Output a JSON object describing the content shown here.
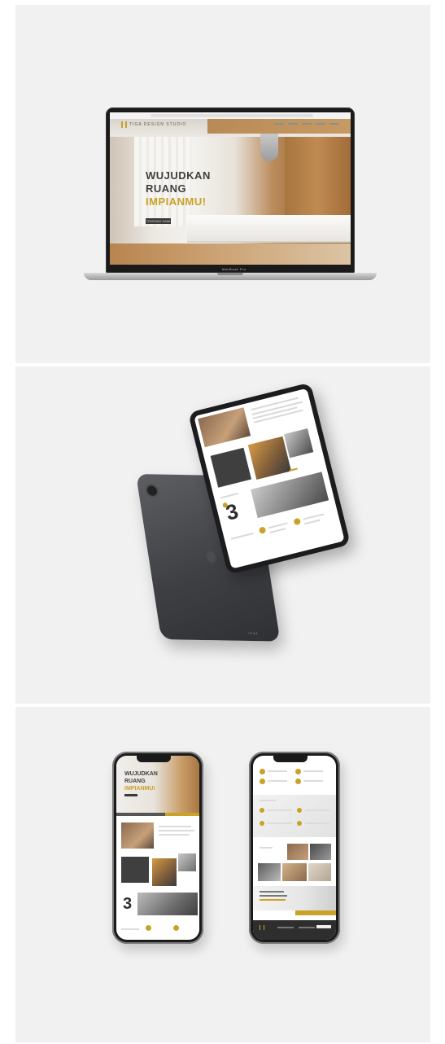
{
  "laptop": {
    "brand": "TIGA DESIGN STUDIO",
    "hero_line1": "WUJUDKAN",
    "hero_line2": "RUANG",
    "hero_line3": "IMPIANMU!",
    "cta": "TENTANG KAMI",
    "device_label": "MacBook Pro"
  },
  "tablet": {
    "number": "3",
    "back_label": "iPad"
  },
  "phone_left": {
    "hero_line1": "WUJUDKAN",
    "hero_line2": "RUANG",
    "hero_line3": "IMPIANMU!",
    "number": "3"
  },
  "colors": {
    "accent": "#c9a227",
    "panel": "#f1f1f1",
    "device": "#1a1a1a"
  }
}
